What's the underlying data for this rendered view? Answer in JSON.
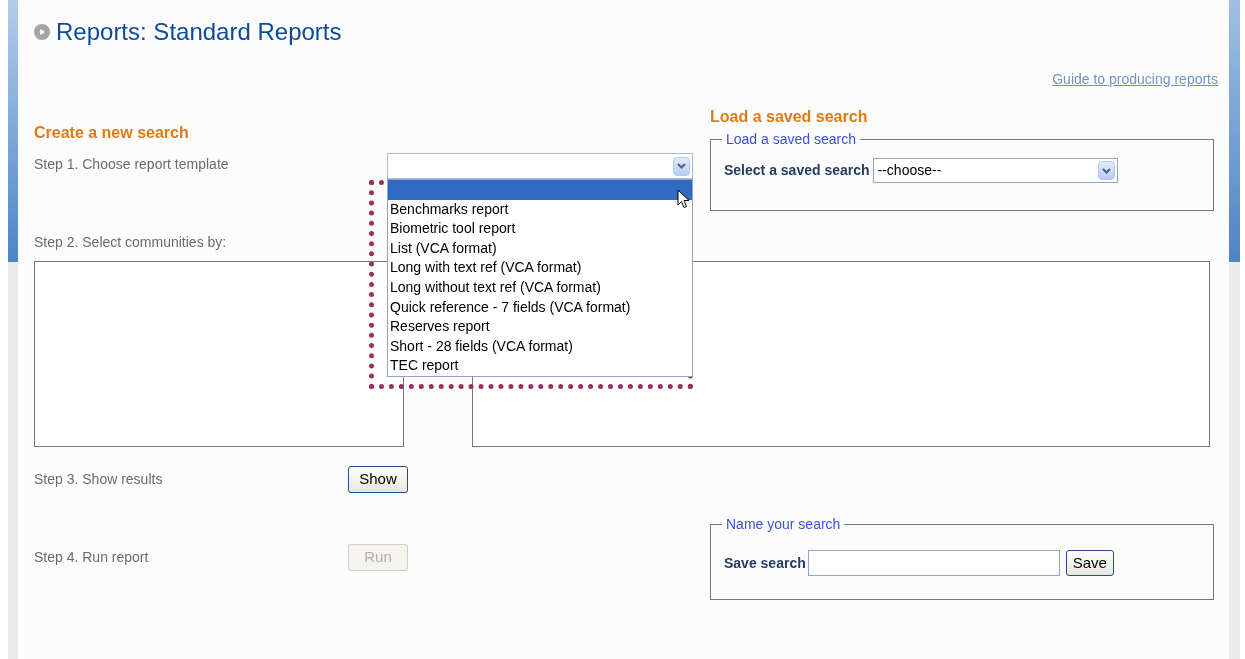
{
  "page": {
    "title": "Reports: Standard Reports",
    "guide_link": "Guide to producing reports"
  },
  "create_search": {
    "heading": "Create a new search",
    "step1": {
      "label": "Step 1. Choose report template",
      "template_select": {
        "expanded": true,
        "options": [
          {
            "selected": true
          },
          {
            "label": "Benchmarks report",
            "selected": false
          },
          {
            "label": "Biometric tool report",
            "selected": false
          },
          {
            "label": "List (VCA format)",
            "selected": false
          },
          {
            "label": "Long with text ref (VCA format)",
            "selected": false
          },
          {
            "label": "Long without text ref (VCA format)",
            "selected": false
          },
          {
            "label": "Quick reference - 7 fields (VCA format)",
            "selected": false
          },
          {
            "label": "Reserves report",
            "selected": false
          },
          {
            "label": "Short - 28 fields (VCA format)",
            "selected": false
          },
          {
            "label": "TEC report",
            "selected": false
          }
        ]
      }
    },
    "step2": {
      "label": "Step 2. Select communities by:"
    },
    "step3": {
      "label": "Step 3. Show results",
      "button": {
        "label": "Show",
        "disabled": false
      }
    },
    "step4": {
      "label": "Step 4. Run report",
      "button": {
        "label": "Run",
        "disabled": true
      }
    }
  },
  "load_search": {
    "heading": "Load a saved search",
    "group_title": "Load a saved search",
    "select_label": "Select a saved search",
    "select_value": "--choose--"
  },
  "save_search": {
    "group_title": "Name your search",
    "field_label": "Save search",
    "button": "Save"
  }
}
